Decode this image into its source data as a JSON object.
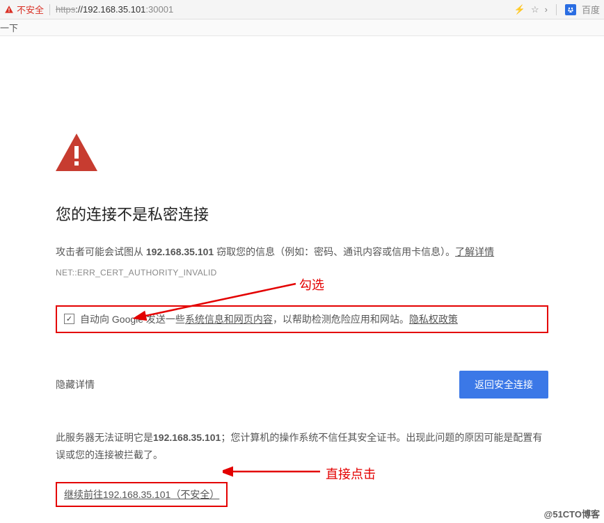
{
  "browser": {
    "security_label": "不安全",
    "url_https": "https",
    "url_host": "://192.168.35.101",
    "url_port": ":30001",
    "star": "☆",
    "chevron": "›",
    "search_label": "百度"
  },
  "tab": {
    "text": "一下"
  },
  "warn": {
    "title": "您的连接不是私密连接",
    "desc_pre": "攻击者可能会试图从 ",
    "desc_ip": "192.168.35.101",
    "desc_post": " 窃取您的信息（例如：密码、通讯内容或信用卡信息）。",
    "learn_more": "了解详情",
    "errcode": "NET::ERR_CERT_AUTHORITY_INVALID"
  },
  "checkbox": {
    "text_pre": "自动向 Google 发送一些",
    "text_underlined": "系统信息和网页内容",
    "text_mid": "，以帮助检测危险应用和网站。",
    "privacy": "隐私权政策",
    "checked": true
  },
  "actions": {
    "hide": "隐藏详情",
    "back": "返回安全连接"
  },
  "server_note": {
    "pre": "此服务器无法证明它是",
    "ip": "192.168.35.101",
    "post": "；您计算机的操作系统不信任其安全证书。出现此问题的原因可能是配置有误或您的连接被拦截了。"
  },
  "proceed": {
    "text": "继续前往192.168.35.101（不安全）"
  },
  "annotations": {
    "a1": "勾选",
    "a2": "直接点击"
  },
  "watermark": "@51CTO博客"
}
